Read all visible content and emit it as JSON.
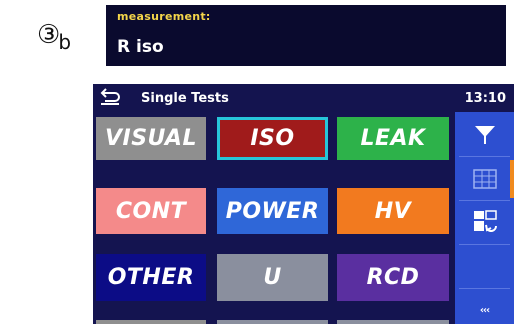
{
  "step": {
    "number": "③",
    "suffix": "b"
  },
  "measurement": {
    "label": "measurement:",
    "value": "R iso"
  },
  "device": {
    "title": "Single Tests",
    "time": "13:10",
    "tiles": [
      {
        "label": "VISUAL",
        "color": "#8f8f8f",
        "selected": false
      },
      {
        "label": "ISO",
        "color": "#a01b1b",
        "selected": true
      },
      {
        "label": "LEAK",
        "color": "#2db24a",
        "selected": false
      },
      {
        "label": "CONT",
        "color": "#f48a8a",
        "selected": false
      },
      {
        "label": "POWER",
        "color": "#2f67d8",
        "selected": false
      },
      {
        "label": "HV",
        "color": "#f27a1f",
        "selected": false
      },
      {
        "label": "OTHER",
        "color": "#0c0c86",
        "selected": false
      },
      {
        "label": "U",
        "color": "#8a8f9e",
        "selected": false
      },
      {
        "label": "RCD",
        "color": "#5a2fa0",
        "selected": false
      }
    ],
    "side_buttons": [
      {
        "icon": "filter-icon"
      },
      {
        "icon": "grid-view-icon"
      },
      {
        "icon": "swap-view-icon"
      }
    ],
    "more_label": "‹‹‹"
  }
}
